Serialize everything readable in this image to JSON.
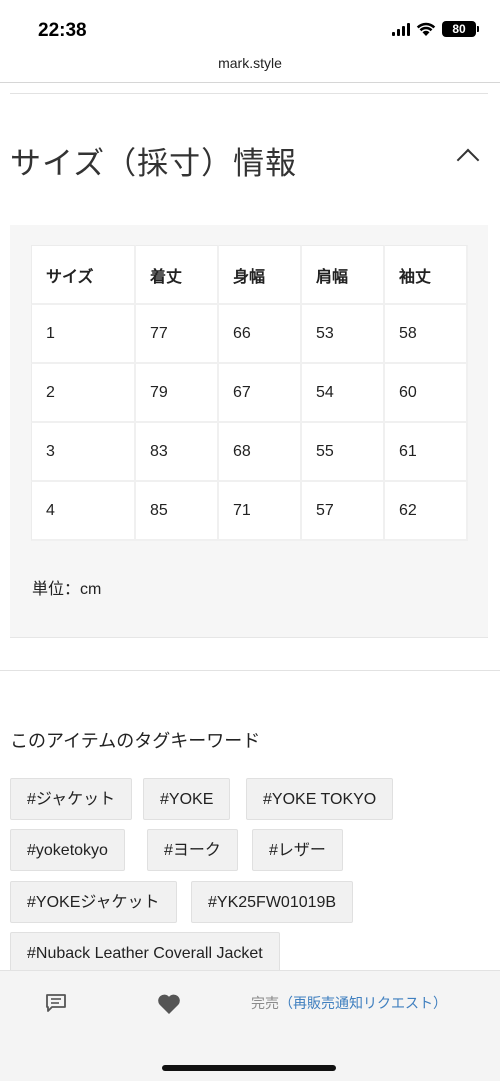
{
  "status_bar": {
    "time": "22:38",
    "battery": "80"
  },
  "browser": {
    "url": "mark.style"
  },
  "size_section": {
    "title": "サイズ（採寸）情報",
    "table": {
      "headers": [
        "サイズ",
        "着丈",
        "身幅",
        "肩幅",
        "袖丈"
      ],
      "rows": [
        [
          "1",
          "77",
          "66",
          "53",
          "58"
        ],
        [
          "2",
          "79",
          "67",
          "54",
          "60"
        ],
        [
          "3",
          "83",
          "68",
          "55",
          "61"
        ],
        [
          "4",
          "85",
          "71",
          "57",
          "62"
        ]
      ]
    },
    "unit": "単位：cm"
  },
  "tags_section": {
    "heading": "このアイテムのタグキーワード",
    "tags": [
      "#ジャケット",
      "#YOKE",
      "#YOKE TOKYO",
      "#yoketokyo",
      "#ヨーク",
      "#レザー",
      "#YOKEジャケット",
      "#YK25FW01019B",
      "#Nuback Leather Coverall Jacket"
    ]
  },
  "bottom_bar": {
    "soldout_label": "完売",
    "restock_label": "（再販売通知リクエスト）",
    "icons": [
      "message-icon",
      "heart-icon"
    ]
  }
}
